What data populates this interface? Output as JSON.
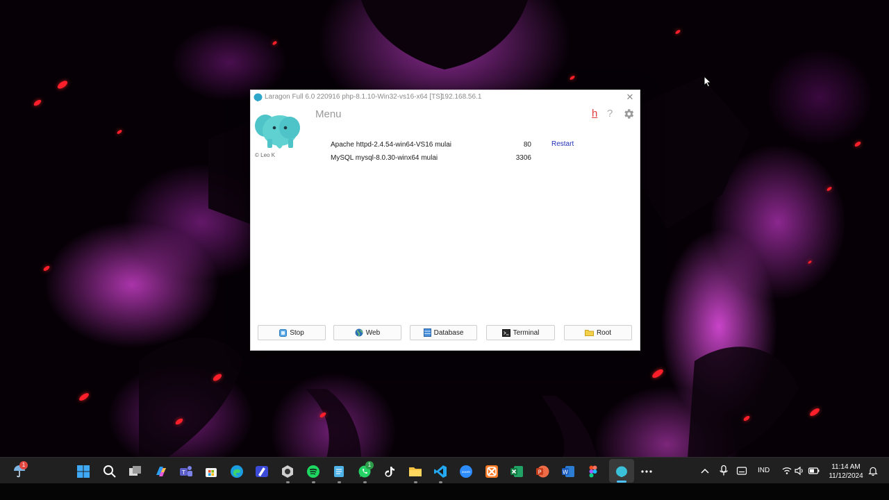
{
  "window": {
    "title": "Laragon Full 6.0 220916 php-8.1.10-Win32-vs16-x64 [TS]",
    "ip": "192.168.56.1",
    "logo_caption": "© Leo K",
    "menu_label": "Menu",
    "toolbar": {
      "h_label": "h",
      "help_label": "?",
      "settings_icon": "gear-icon"
    }
  },
  "services": [
    {
      "name": "Apache httpd-2.4.54-win64-VS16 mulai",
      "port": "80",
      "action": "Restart"
    },
    {
      "name": "MySQL mysql-8.0.30-winx64 mulai",
      "port": "3306",
      "action": ""
    }
  ],
  "buttons": {
    "stop": "Stop",
    "web": "Web",
    "database": "Database",
    "terminal": "Terminal",
    "root": "Root"
  },
  "taskbar": {
    "weather_badge": "1",
    "whatsapp_badge": "1",
    "lang": "IND",
    "time": "11:14 AM",
    "date": "11/12/2024"
  },
  "colors": {
    "accent_link": "#1f2fb8",
    "h_red": "#e23b3b",
    "laragon_teal": "#5ecfcf"
  }
}
